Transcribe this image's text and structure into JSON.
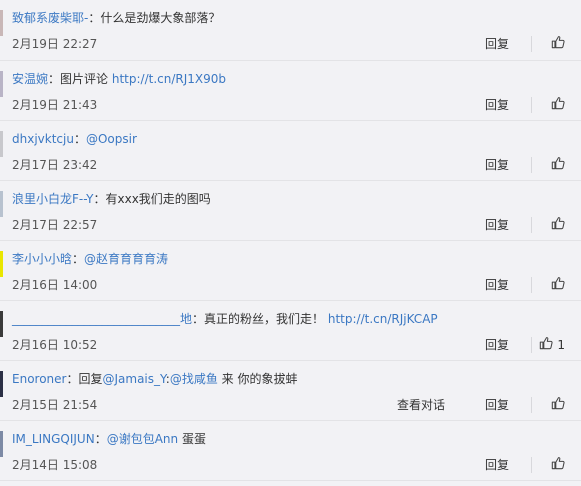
{
  "labels": {
    "reply": "回复",
    "view_conversation": "查看对话"
  },
  "comments": [
    {
      "username": "致郁系废柴耶-",
      "sep": "：",
      "parts": [
        {
          "type": "plain",
          "text": "什么是劲爆大象部落？"
        }
      ],
      "time": "2月19日 22:27",
      "likes": "",
      "view_conversation": false,
      "avatar_color": "#c9b7b7"
    },
    {
      "username": "安温婉",
      "sep": "：",
      "parts": [
        {
          "type": "plain",
          "text": "图片评论 "
        },
        {
          "type": "link",
          "text": "http://t.cn/RJ1X90b"
        }
      ],
      "time": "2月19日 21:43",
      "likes": "",
      "view_conversation": false,
      "avatar_color": "#b9b4c6"
    },
    {
      "username": "dhxjvktcju",
      "sep": "：",
      "parts": [
        {
          "type": "mention",
          "text": "@Oopsir"
        }
      ],
      "time": "2月17日 23:42",
      "likes": "",
      "view_conversation": false,
      "avatar_color": "#c8c8cc"
    },
    {
      "username": "浪里小白龙F--Y",
      "sep": "：",
      "parts": [
        {
          "type": "plain",
          "text": "有xxx我们走的图吗"
        }
      ],
      "time": "2月17日 22:57",
      "likes": "",
      "view_conversation": false,
      "avatar_color": "#b8c2cf"
    },
    {
      "username": "李小小小晗",
      "sep": "：",
      "parts": [
        {
          "type": "mention",
          "text": "@赵育育育育涛"
        }
      ],
      "time": "2月16日 14:00",
      "likes": "",
      "view_conversation": false,
      "avatar_color": "#e9e600"
    },
    {
      "username": "____________________________地",
      "sep": "：",
      "parts": [
        {
          "type": "plain",
          "text": "真正的粉丝，我们走！ "
        },
        {
          "type": "link",
          "text": "http://t.cn/RJjKCAP"
        }
      ],
      "time": "2月16日 10:52",
      "likes": "1",
      "view_conversation": false,
      "avatar_color": "#3a3a3a"
    },
    {
      "username": "Enoroner",
      "sep": "：",
      "parts": [
        {
          "type": "plain",
          "text": "回复"
        },
        {
          "type": "mention",
          "text": "@Jamais_Y"
        },
        {
          "type": "plain",
          "text": ":"
        },
        {
          "type": "mention",
          "text": "@找咸鱼"
        },
        {
          "type": "plain",
          "text": " 来 你的象拔蚌"
        }
      ],
      "time": "2月15日 21:54",
      "likes": "",
      "view_conversation": true,
      "avatar_color": "#2b2f45"
    },
    {
      "username": "IM_LINGQIJUN",
      "sep": "：",
      "parts": [
        {
          "type": "mention",
          "text": "@谢包包Ann"
        },
        {
          "type": "plain",
          "text": " 蛋蛋"
        }
      ],
      "time": "2月14日 15:08",
      "likes": "",
      "view_conversation": false,
      "avatar_color": "#7d8aa5"
    }
  ]
}
